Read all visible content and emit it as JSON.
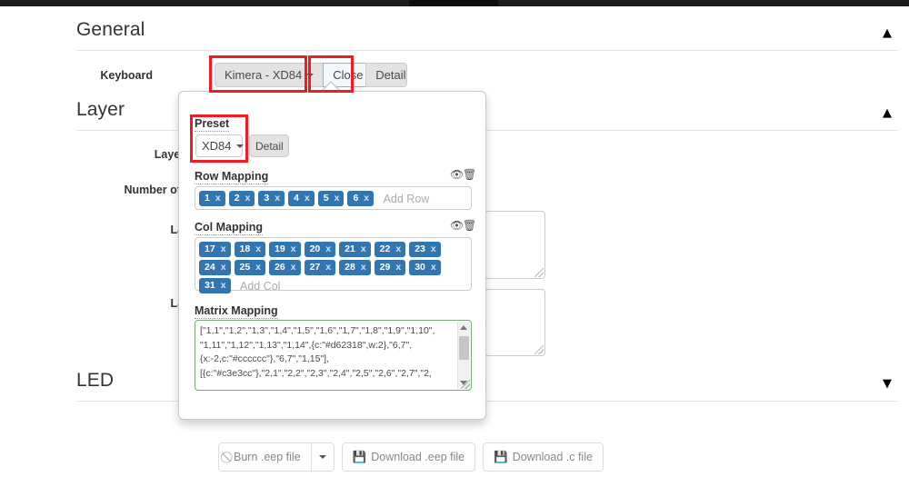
{
  "sections": {
    "general": {
      "title": "General",
      "chevron": "chevron-up"
    },
    "layer": {
      "title": "Layer",
      "chevron": "chevron-up"
    },
    "led": {
      "title": "LED",
      "chevron": "chevron-down"
    }
  },
  "general_form": {
    "keyboard_label": "Keyboard",
    "keyboard_value": "Kimera - XD84",
    "close_label": "Close",
    "detail_label": "Detail"
  },
  "layer_form": {
    "labels": [
      "Layer M",
      "Number of La",
      "Lay",
      "Lay"
    ]
  },
  "popover": {
    "preset": {
      "label": "Preset",
      "value": "XD84",
      "detail_label": "Detail"
    },
    "row_mapping": {
      "label": "Row Mapping",
      "eye_icon": "eye-icon",
      "trash_icon": "trash-icon",
      "tags": [
        "1",
        "2",
        "3",
        "4",
        "5",
        "6"
      ],
      "tag_remove": "x",
      "placeholder": "Add Row"
    },
    "col_mapping": {
      "label": "Col Mapping",
      "eye_icon": "eye-icon",
      "trash_icon": "trash-icon",
      "tags": [
        "17",
        "18",
        "19",
        "20",
        "21",
        "22",
        "23",
        "24",
        "25",
        "26",
        "27",
        "28",
        "29",
        "30",
        "31"
      ],
      "tag_remove": "x",
      "placeholder": "Add Col"
    },
    "matrix_mapping": {
      "label": "Matrix Mapping",
      "value": "[\"1,1\",\"1,2\",\"1,3\",\"1,4\",\"1,5\",\"1,6\",\"1,7\",\"1,8\",\"1,9\",\"1,10\",\n\"1,11\",\"1,12\",\"1,13\",\"1,14\",{c:\"#d62318\",w:2},\"6,7\",\n{x:-2,c:\"#cccccc\"},\"6,7\",\"1,15\"],\n[{c:\"#c3e3cc\"},\"2,1\",\"2,2\",\"2,3\",\"2,4\",\"2,5\",\"2,6\",\"2,7\",\"2,"
    }
  },
  "footer": {
    "burn_label": "Burn .eep file",
    "burn_icon": "ban-icon",
    "dropdown_icon": "caret-down-icon",
    "download_eep_label": "Download .eep file",
    "download_eep_icon": "save-icon",
    "download_c_label": "Download .c file",
    "download_c_icon": "save-icon"
  },
  "annotations": {
    "accent_color": "#ee1c25",
    "boxes": [
      "keyboard-select-highlight",
      "close-button-highlight",
      "preset-select-highlight"
    ]
  },
  "colors": {
    "tag_blue": "#3276b1",
    "heading_gray": "#333333",
    "matrix_border_green": "#7aa87a"
  }
}
